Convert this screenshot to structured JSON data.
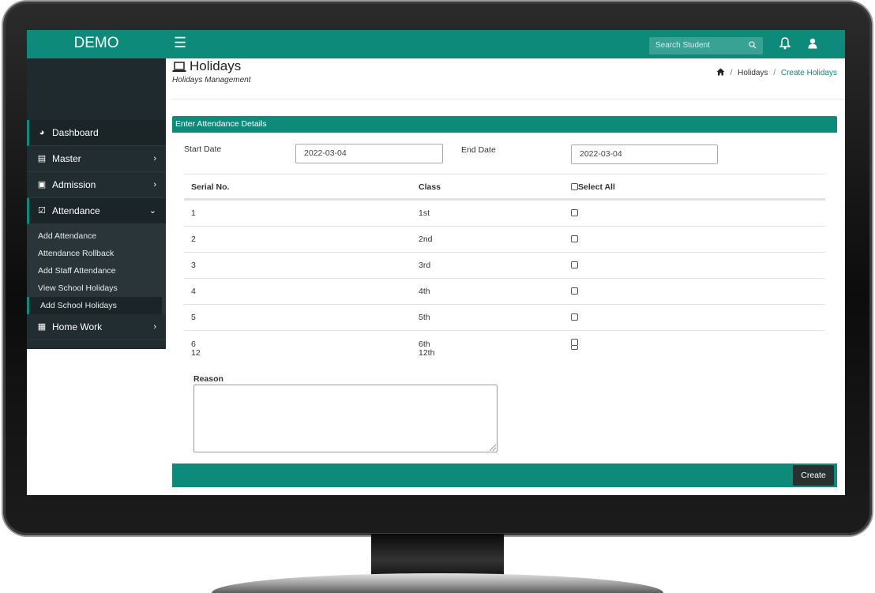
{
  "sidebar": {
    "brand": "DEMO",
    "menu": [
      {
        "label": "Dashboard",
        "icon": "dashboard-icon",
        "chevron": ""
      },
      {
        "label": "Master",
        "icon": "database-icon",
        "chevron": "›"
      },
      {
        "label": "Admission",
        "icon": "form-icon",
        "chevron": "›"
      }
    ],
    "attendance": {
      "label": "Attendance",
      "icon": "calendar-check-icon",
      "chevron": "⌄"
    },
    "submenu": [
      "Add Attendance",
      "Attendance Rollback",
      "Add Staff Attendance",
      "View School Holidays",
      "Add School Holidays"
    ],
    "homework": {
      "label": "Home Work",
      "icon": "keyboard-icon",
      "chevron": "›"
    }
  },
  "topbar": {
    "menu_icon": "☰",
    "search_placeholder": "Search Student"
  },
  "header": {
    "title": "Holidays",
    "subtitle": "Holidays Management",
    "breadcrumb": {
      "home": "home-icon",
      "parent": "Holidays",
      "current": "Create Holidays"
    }
  },
  "form": {
    "section_title": "Enter Attendance Details",
    "start_date_label": "Start Date",
    "start_date_value": "2022-03-04",
    "end_date_label": "End Date",
    "end_date_value": "2022-03-04",
    "table": {
      "headers": [
        "Serial No.",
        "Class",
        "Select All"
      ],
      "rows": [
        {
          "serial": "1",
          "class": "1st"
        },
        {
          "serial": "2",
          "class": "2nd"
        },
        {
          "serial": "3",
          "class": "3rd"
        },
        {
          "serial": "4",
          "class": "4th"
        },
        {
          "serial": "5",
          "class": "5th"
        },
        {
          "serial": "6",
          "class": "6th"
        }
      ],
      "partial_row": {
        "serial": "12",
        "class": "12th"
      }
    },
    "reason_label": "Reason",
    "reason_value": "",
    "submit_label": "Create"
  },
  "colors": {
    "accent": "#0e8a7a",
    "sidebar": "#202b2f",
    "button": "#2a2f30"
  }
}
